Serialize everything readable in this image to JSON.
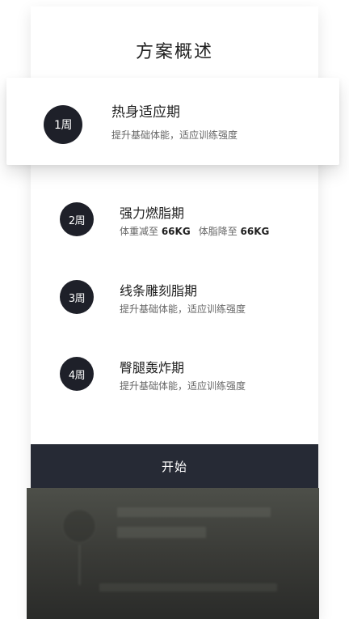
{
  "header": {
    "title": "方案概述"
  },
  "weeks": [
    {
      "badge": "1周",
      "title": "热身适应期",
      "desc": "提升基础体能，适应训练强度"
    },
    {
      "badge": "2周",
      "title": "强力燃脂期",
      "desc_part1": "体重减至 ",
      "desc_value1": "66KG",
      "desc_part2": "体脂降至 ",
      "desc_value2": "66KG"
    },
    {
      "badge": "3周",
      "title": "线条雕刻脂期",
      "desc": "提升基础体能，适应训练强度"
    },
    {
      "badge": "4周",
      "title": "臀腿轰炸期",
      "desc": "提升基础体能，适应训练强度"
    }
  ],
  "start_button": {
    "label": "开始"
  }
}
